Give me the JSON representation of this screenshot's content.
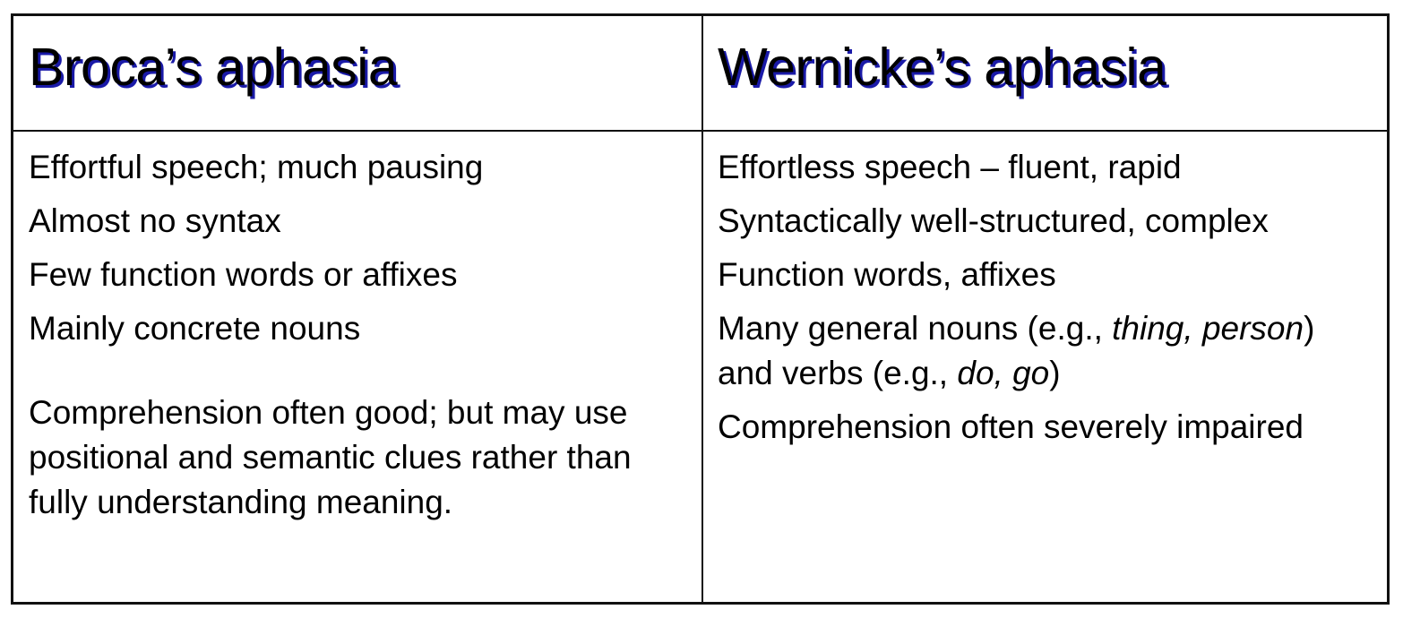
{
  "table": {
    "headers": {
      "left": "Broca’s aphasia",
      "right": "Wernicke’s aphasia"
    },
    "left_rows": [
      "Effortful speech; much pausing",
      "Almost no syntax",
      "Few function words or affixes",
      "Mainly concrete nouns",
      "Comprehension often good; but may use positional and semantic clues rather than fully understanding meaning."
    ],
    "right_rows": [
      "Effortless speech – fluent, rapid",
      "Syntactically well-structured, complex",
      "Function words, affixes",
      {
        "part1": "Many general nouns (e.g., ",
        "italic1": "thing, person",
        "part2": ") and verbs (e.g., ",
        "italic2": "do, go",
        "part3": ")"
      },
      "Comprehension often severely impaired"
    ]
  }
}
